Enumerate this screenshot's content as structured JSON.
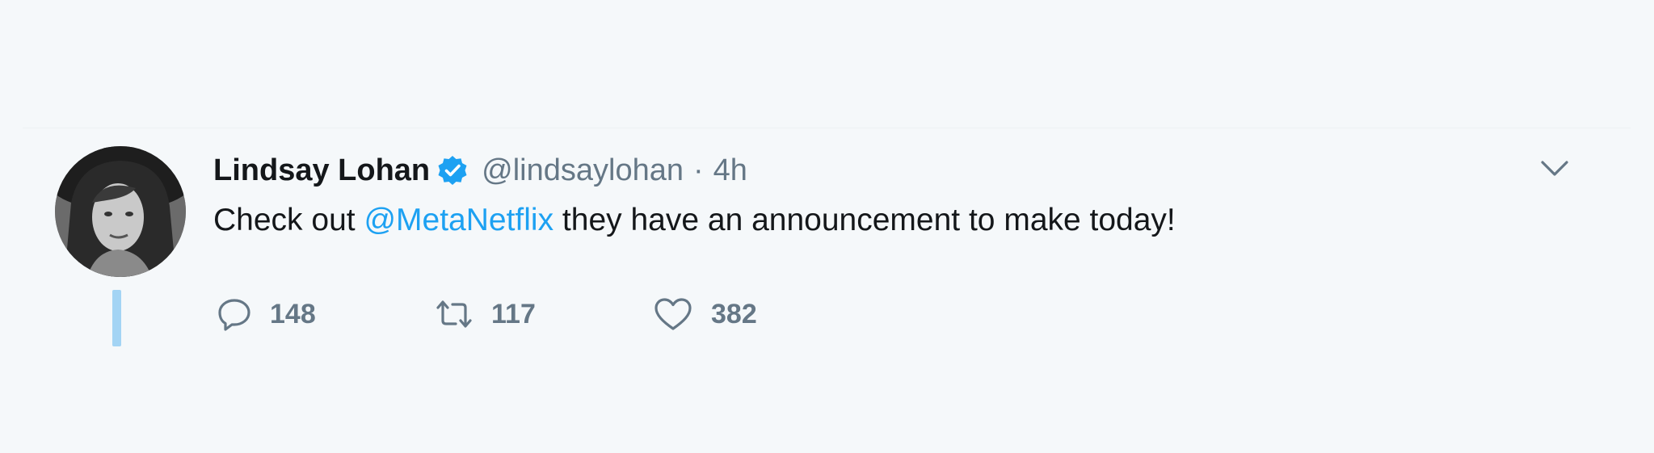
{
  "tweet": {
    "author_name": "Lindsay Lohan",
    "handle": "@lindsaylohan",
    "separator": "·",
    "time": "4h",
    "text_before": "Check out ",
    "mention": "@MetaNetflix",
    "text_after": " they have an announcement to make today!",
    "verified": true
  },
  "actions": {
    "reply": {
      "icon": "reply-bubble-icon",
      "count": "148"
    },
    "retweet": {
      "icon": "retweet-icon",
      "count": "117"
    },
    "like": {
      "icon": "heart-icon",
      "count": "382"
    }
  },
  "menu": {
    "icon": "chevron-down-icon"
  },
  "colors": {
    "background": "#f5f8fa",
    "text": "#14171a",
    "secondary_text": "#657786",
    "accent": "#1da1f2",
    "thread_line": "#a3d4f4"
  }
}
